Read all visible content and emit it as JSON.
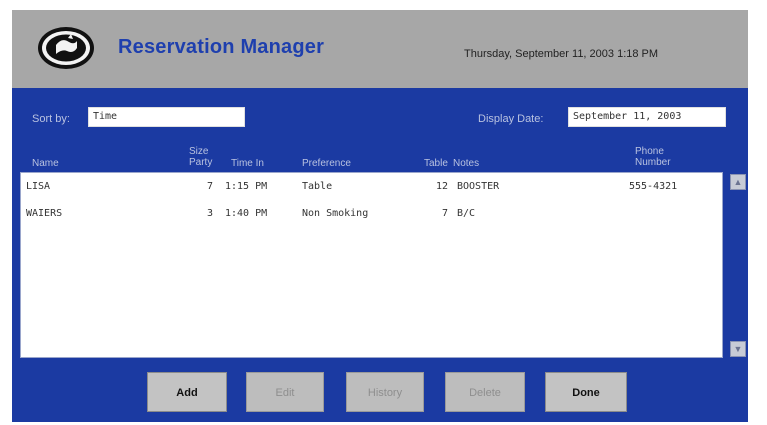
{
  "header": {
    "title": "Reservation Manager",
    "datetime": "Thursday, September 11, 2003 1:18 PM"
  },
  "controls": {
    "sort_label": "Sort by:",
    "sort_value": "Time",
    "display_date_label": "Display Date:",
    "display_date_value": "September 11, 2003"
  },
  "columns": {
    "name": "Name",
    "party": [
      "Size",
      "Party"
    ],
    "time": "Time In",
    "preference": "Preference",
    "table": "Table",
    "notes": "Notes",
    "phone": [
      "Phone",
      "Number"
    ]
  },
  "reservations": [
    {
      "name": "LISA",
      "party": "7",
      "time": "1:15 PM",
      "preference": "Table",
      "table": "12",
      "notes": "BOOSTER",
      "phone": "555-4321"
    },
    {
      "name": "WAIERS",
      "party": "3",
      "time": "1:40 PM",
      "preference": "Non Smoking",
      "table": "7",
      "notes": "B/C",
      "phone": ""
    }
  ],
  "buttons": {
    "add": "Add",
    "edit": "Edit",
    "history": "History",
    "delete": "Delete",
    "done": "Done"
  },
  "colors": {
    "panel": "#1b3aa2",
    "header": "#a7a7a7",
    "title": "#1e3fae"
  },
  "icons": {
    "logo": "restaurant-logo-icon",
    "scroll_up": "scroll-up-arrow-icon",
    "scroll_down": "scroll-down-arrow-icon"
  }
}
